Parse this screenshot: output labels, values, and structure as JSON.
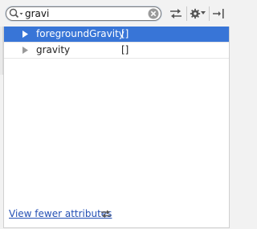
{
  "search": {
    "value": "gravi",
    "icon": "search-icon",
    "clear_icon": "clear-icon"
  },
  "toolbar": {
    "icons": [
      "swap-arrows-icon",
      "gear-icon",
      "chevron-down-icon",
      "pin-icon"
    ]
  },
  "attributes": [
    {
      "name": "foregroundGravity",
      "value": "[]",
      "selected": true
    },
    {
      "name": "gravity",
      "value": "[]",
      "selected": false
    }
  ],
  "footer": {
    "link_label": "View fewer attributes",
    "icon": "swap-arrows-icon"
  },
  "colors": {
    "selection": "#3875d7",
    "link": "#2450b4",
    "panel_bg": "#f2f2f2"
  }
}
